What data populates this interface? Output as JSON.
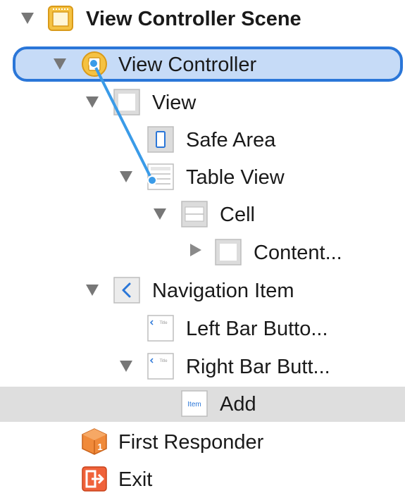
{
  "outline": {
    "scene_label": "View Controller Scene",
    "view_controller_label": "View Controller",
    "view_label": "View",
    "safe_area_label": "Safe Area",
    "table_view_label": "Table View",
    "cell_label": "Cell",
    "content_label": "Content...",
    "navigation_item_label": "Navigation Item",
    "left_bar_button_label": "Left Bar Butto...",
    "right_bar_button_label": "Right Bar Butt...",
    "add_label": "Add",
    "first_responder_label": "First Responder",
    "exit_label": "Exit"
  },
  "icons": {
    "title_text": "Title",
    "item_text": "Item",
    "first_responder_number": "1"
  },
  "colors": {
    "selection_fill": "#c6dbf7",
    "selection_border": "#2a76d8",
    "connector": "#3a9be8",
    "scene_icon": "#f5c242",
    "first_responder_icon": "#f08a3a",
    "exit_icon": "#f0623a",
    "highlight_row": "#dedede"
  }
}
